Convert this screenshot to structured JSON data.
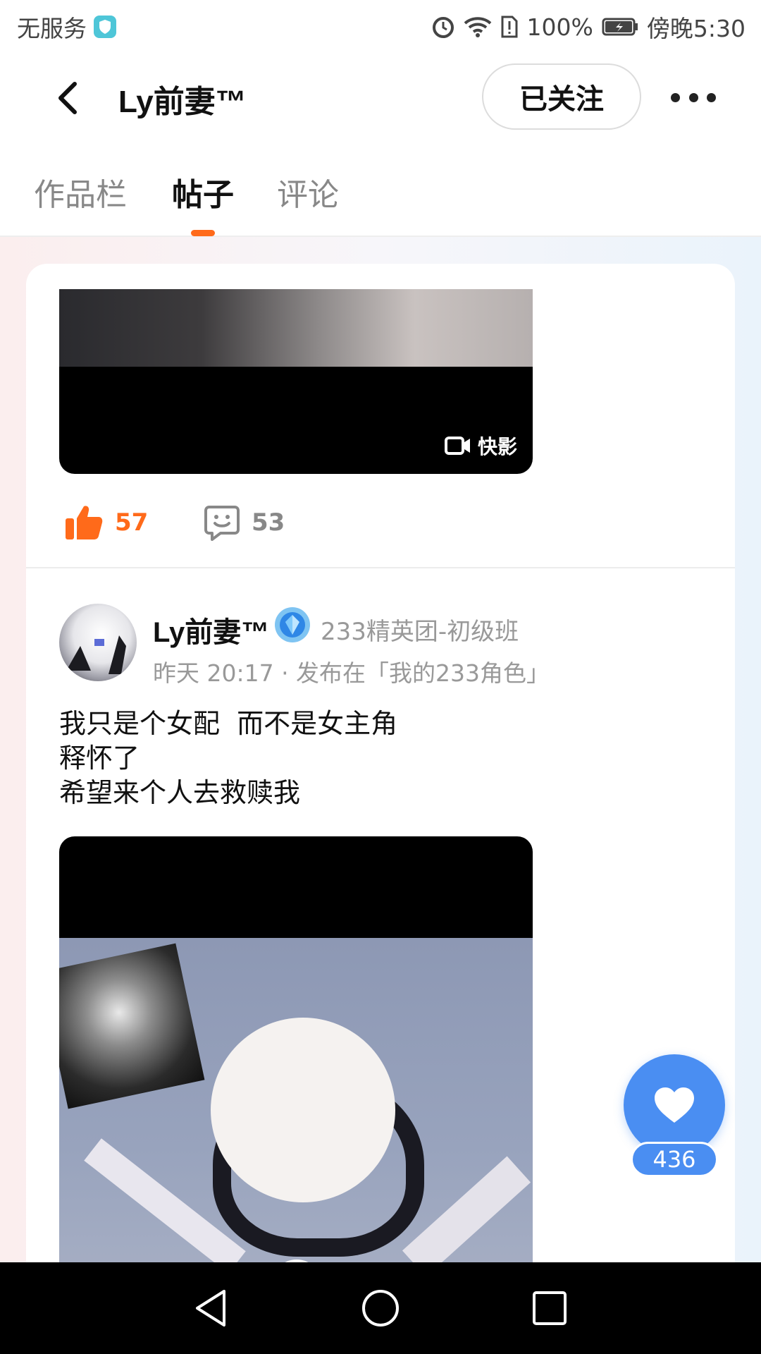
{
  "status_bar": {
    "carrier": "无服务",
    "battery": "100%",
    "time": "傍晚5:30"
  },
  "header": {
    "title": "Ly前妻™",
    "follow_label": "已关注"
  },
  "tabs": [
    {
      "label": "作品栏",
      "active": false
    },
    {
      "label": "帖子",
      "active": true
    },
    {
      "label": "评论",
      "active": false
    }
  ],
  "post1": {
    "watermark": "快影",
    "like_count": "57",
    "comment_count": "53"
  },
  "post2": {
    "author": "Ly前妻™",
    "badge": "233精英团-初级班",
    "meta": "昨天 20:17 · 发布在「我的233角色」",
    "lines": [
      "我只是个女配  而不是女主角",
      "释怀了",
      "希望来个人去救赎我"
    ]
  },
  "floating_like": {
    "count": "436"
  },
  "colors": {
    "accent": "#ff6a1a",
    "like_fab": "#4a8ef2"
  },
  "icons": [
    "shield-icon",
    "alarm-icon",
    "wifi-icon",
    "sim-alert-icon",
    "battery-icon",
    "back-icon",
    "more-icon",
    "video-camera-icon",
    "thumbs-up-icon",
    "comment-icon",
    "heart-icon",
    "nav-back-icon",
    "nav-home-icon",
    "nav-recents-icon"
  ]
}
